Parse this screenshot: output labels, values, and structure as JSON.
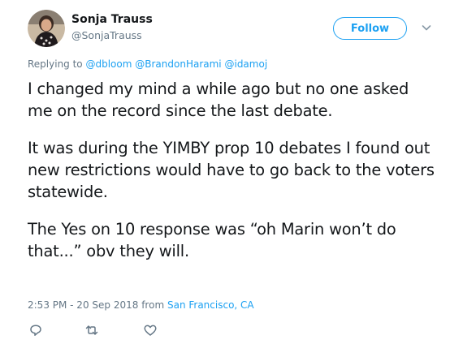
{
  "author": {
    "name": "Sonja Trauss",
    "handle": "@SonjaTrauss"
  },
  "follow_label": "Follow",
  "reply": {
    "prefix": "Replying to",
    "mentions": [
      "@dbloom",
      "@BrandonHarami",
      "@idamoj"
    ]
  },
  "tweet": {
    "paragraphs": [
      "I changed my mind a while ago but no one asked me on the record since the last debate.",
      "It was during the YIMBY prop 10 debates I found out new restrictions would have to go back to the voters statewide.",
      "The Yes on 10 response was “oh Marin won’t do that...” obv they will."
    ]
  },
  "meta": {
    "time": "2:53 PM - 20 Sep 2018",
    "from": "from",
    "location": "San Francisco, CA"
  },
  "icons": {
    "reply": "reply-icon",
    "retweet": "retweet-icon",
    "like": "heart-icon",
    "caret": "chevron-down-icon"
  },
  "colors": {
    "accent": "#1da1f2",
    "secondary_text": "#657786",
    "primary_text": "#14171a"
  }
}
